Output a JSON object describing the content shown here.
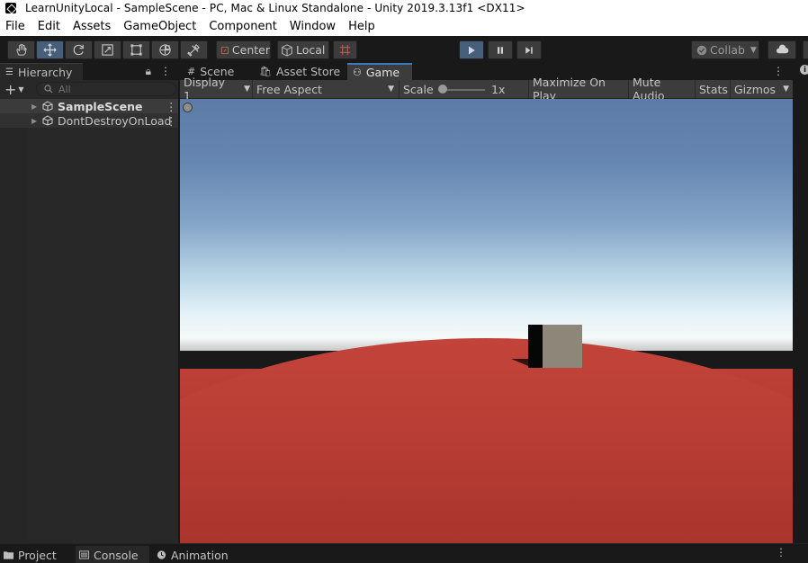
{
  "window": {
    "title": "LearnUnityLocal - SampleScene - PC, Mac & Linux Standalone - Unity 2019.3.13f1 <DX11>"
  },
  "menu": [
    "File",
    "Edit",
    "Assets",
    "GameObject",
    "Component",
    "Window",
    "Help"
  ],
  "toolbar": {
    "tools": [
      "hand-tool",
      "move-tool",
      "rotate-tool",
      "scale-tool",
      "rect-tool",
      "transform-tool",
      "custom-tool"
    ],
    "pivot_label": "Center",
    "space_label": "Local",
    "collab_label": "Collab",
    "colors": {
      "active_tool": "#46607c",
      "play_active": "#46607c"
    }
  },
  "hierarchy": {
    "tab_label": "Hierarchy",
    "search_placeholder": "All",
    "items": [
      {
        "label": "SampleScene",
        "kind": "scene"
      },
      {
        "label": "DontDestroyOnLoad",
        "kind": "scene"
      }
    ]
  },
  "tabs": {
    "scene": "Scene",
    "asset_store": "Asset Store",
    "game": "Game"
  },
  "game_toolbar": {
    "display": "Display 1",
    "aspect": "Free Aspect",
    "scale_label": "Scale",
    "scale_value": "1x",
    "maximize": "Maximize On Play",
    "mute": "Mute Audio",
    "stats": "Stats",
    "gizmos": "Gizmos"
  },
  "scene_colors": {
    "sky_top": "#5d7ca8",
    "horizon": "#f4f8f8",
    "ground": "#bc4037",
    "cube": "#8c8778"
  },
  "bottom_tabs": [
    "Project",
    "Console",
    "Animation"
  ]
}
